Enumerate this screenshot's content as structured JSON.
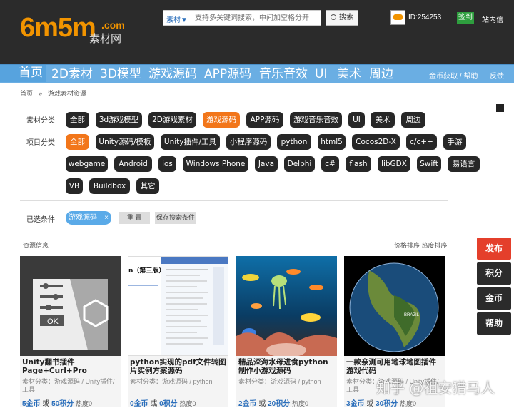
{
  "logo": {
    "big": "6m5m",
    "com": ".com",
    "cn": "素材网"
  },
  "search": {
    "type": "素材▼",
    "placeholder": "支持多关键词搜索，中间加空格分开",
    "button": "搜索"
  },
  "user": {
    "id": "ID:254253",
    "signin": "签到",
    "messages": "站内信"
  },
  "nav": {
    "items": [
      "首页",
      "2D素材",
      "3D模型",
      "游戏源码",
      "APP源码",
      "音乐音效",
      "UI",
      "美术",
      "周边"
    ],
    "right": [
      "金币获取 / 帮助",
      "反馈"
    ]
  },
  "breadcrumb": [
    "首页",
    "»",
    "游戏素材资源"
  ],
  "filters": {
    "category_label": "素材分类",
    "categories": [
      "全部",
      "3d游戏模型",
      "2D游戏素材",
      "游戏源码",
      "APP源码",
      "游戏音乐音效",
      "UI",
      "美术",
      "周边"
    ],
    "category_active": "游戏源码",
    "project_label": "项目分类",
    "projects": [
      "全部",
      "Unity源码/模板",
      "Unity插件/工具",
      "小程序源码",
      "python",
      "html5",
      "Cocos2D-X",
      "c/c++",
      "手游",
      "webgame",
      "Android",
      "ios",
      "Windows Phone",
      "Java",
      "Delphi",
      "c#",
      "flash",
      "libGDX",
      "Swift",
      "易语言",
      "VB",
      "Buildbox",
      "其它"
    ],
    "project_active": "全部"
  },
  "selected": {
    "label": "已选条件",
    "chip": "游戏源码",
    "chip_close": "×",
    "reset": "重 置",
    "save": "保存搜索条件"
  },
  "results": {
    "info": "资源信息",
    "sort": "价格排序  热度排序"
  },
  "cards": [
    {
      "title": "Unity翻书插件Page+Curl+Pro",
      "category": "素材分类：游戏源码 / Unity插件/工具",
      "gold": "5金币",
      "or": "或",
      "points": "50积分",
      "heat": "热度0"
    },
    {
      "title": "python实现的pdf文件转图片实例方案源码",
      "category": "素材分类：游戏源码 / python",
      "gold": "0金币",
      "or": "或",
      "points": "0积分",
      "heat": "热度0"
    },
    {
      "title": "精品深海水母进食python制作小游戏源码",
      "category": "素材分类：游戏源码 / python",
      "gold": "2金币",
      "or": "或",
      "points": "20积分",
      "heat": "热度0"
    },
    {
      "title": "一款亲测可用地球地图插件游戏代码",
      "category": "素材分类：游戏源码 / Unity插件/工具",
      "gold": "3金币",
      "or": "或",
      "points": "30积分",
      "heat": "热度0"
    }
  ],
  "thumb_texts": {
    "ok": "OK",
    "pdf_title": "n（第三版）",
    "brazil": "BRAZIL"
  },
  "side": [
    "发布",
    "积分",
    "金币",
    "帮助"
  ],
  "watermark": "知乎 @祖安猎马人",
  "colors": {
    "accent": "#f2761a",
    "nav": "#6aaee3",
    "dark": "#2b2b2b",
    "price": "#2a6ebb"
  }
}
